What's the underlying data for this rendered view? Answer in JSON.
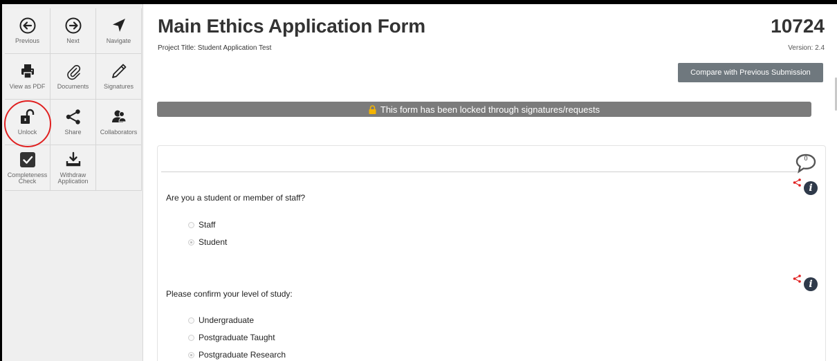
{
  "toolbar": {
    "previous": "Previous",
    "next": "Next",
    "navigate": "Navigate",
    "view_pdf": "View as PDF",
    "documents": "Documents",
    "signatures": "Signatures",
    "unlock": "Unlock",
    "share": "Share",
    "collaborators": "Collaborators",
    "completeness_1": "Completeness",
    "completeness_2": "Check",
    "withdraw_1": "Withdraw",
    "withdraw_2": "Application"
  },
  "header": {
    "title": "Main Ethics Application Form",
    "project_title": "Project Title: Student Application Test",
    "app_number": "10724",
    "version": "Version: 2.4",
    "compare_button": "Compare with Previous Submission"
  },
  "banner": {
    "locked_text": "This form has been locked through signatures/requests",
    "color": "#7b7b7b"
  },
  "comments": {
    "count": "0"
  },
  "questions": [
    {
      "text": "Are you a student or member of staff?",
      "options": [
        "Staff",
        "Student"
      ],
      "selected": "Student"
    },
    {
      "text": "Please confirm your level of study:",
      "options": [
        "Undergraduate",
        "Postgraduate Taught",
        "Postgraduate Research"
      ],
      "selected": "Postgraduate Research"
    }
  ],
  "colors": {
    "accent_red": "#e02020",
    "info_icon": "#2f3a4a",
    "button_gray": "#6f787e"
  }
}
